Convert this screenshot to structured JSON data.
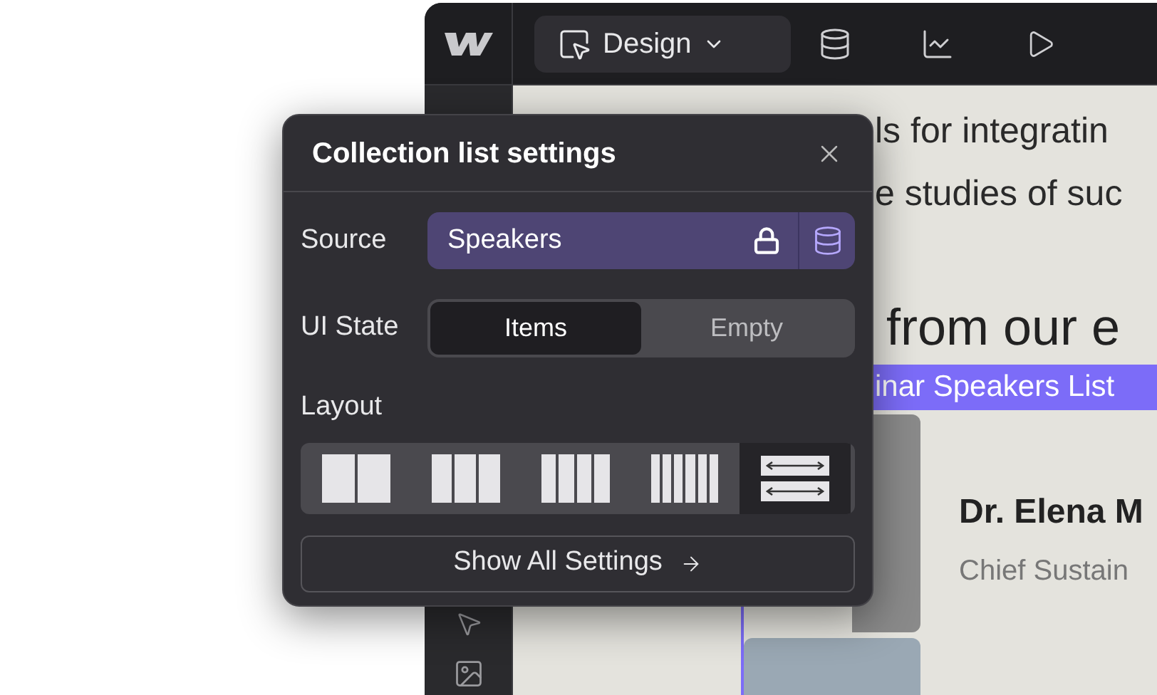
{
  "toolbar": {
    "mode_button": "Design"
  },
  "canvas": {
    "text_lines": [
      "ls for integratin",
      "e studies of suc"
    ],
    "heading": "from our e",
    "selection_label": "inar Speakers List",
    "speaker": {
      "name": "Dr. Elena M",
      "role": "Chief Sustain"
    }
  },
  "popover": {
    "title": "Collection list settings",
    "source": {
      "label": "Source",
      "value": "Speakers",
      "locked": true
    },
    "ui_state": {
      "label": "UI State",
      "options": [
        {
          "label": "Items",
          "selected": true
        },
        {
          "label": "Empty",
          "selected": false
        }
      ]
    },
    "layout": {
      "label": "Layout",
      "options": [
        {
          "kind": "two",
          "selected": false
        },
        {
          "kind": "three",
          "selected": false
        },
        {
          "kind": "four",
          "selected": false
        },
        {
          "kind": "six",
          "selected": false
        },
        {
          "kind": "list",
          "selected": true
        }
      ]
    },
    "button": "Show All Settings"
  }
}
